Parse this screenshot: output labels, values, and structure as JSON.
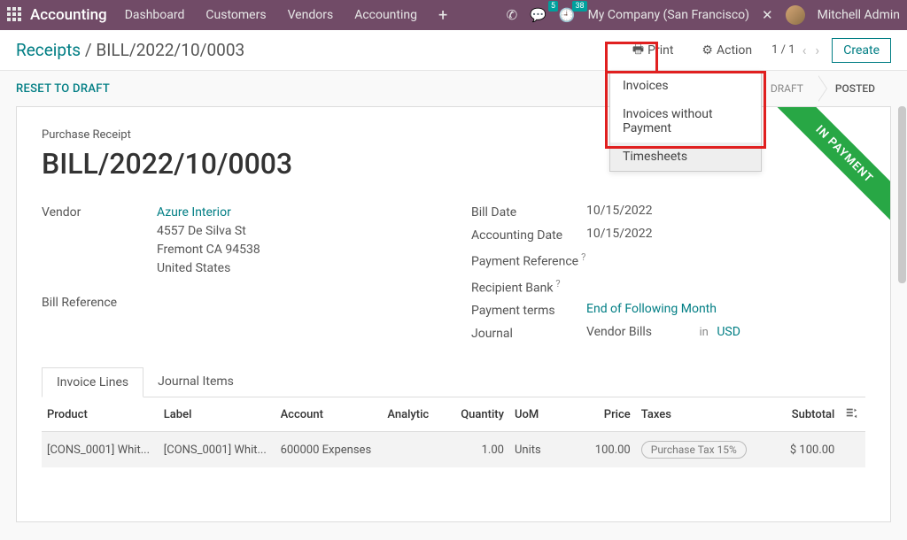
{
  "topbar": {
    "app_name": "Accounting",
    "nav": [
      "Dashboard",
      "Customers",
      "Vendors",
      "Accounting"
    ],
    "messages_count": "5",
    "activities_count": "38",
    "company": "My Company (San Francisco)",
    "user": "Mitchell Admin"
  },
  "breadcrumb": {
    "root": "Receipts",
    "current": "BILL/2022/10/0003"
  },
  "controls": {
    "print": "Print",
    "action": "Action",
    "pager": "1 / 1",
    "create": "Create"
  },
  "print_menu": [
    "Invoices",
    "Invoices without Payment",
    "Timesheets"
  ],
  "statusbar": {
    "reset": "Reset To Draft",
    "draft": "Draft",
    "posted": "Posted"
  },
  "ribbon": "In Payment",
  "record": {
    "title_label": "Purchase Receipt",
    "title": "BILL/2022/10/0003",
    "vendor_label": "Vendor",
    "vendor_name": "Azure Interior",
    "vendor_addr1": "4557 De Silva St",
    "vendor_addr2": "Fremont CA 94538",
    "vendor_country": "United States",
    "bill_ref_label": "Bill Reference",
    "bill_date_label": "Bill Date",
    "bill_date": "10/15/2022",
    "acc_date_label": "Accounting Date",
    "acc_date": "10/15/2022",
    "pay_ref_label": "Payment Reference",
    "recip_bank_label": "Recipient Bank",
    "terms_label": "Payment terms",
    "terms": "End of Following Month",
    "journal_label": "Journal",
    "journal": "Vendor Bills",
    "in": "in",
    "currency": "USD"
  },
  "tabs": {
    "lines": "Invoice Lines",
    "journal": "Journal Items"
  },
  "columns": {
    "product": "Product",
    "label": "Label",
    "account": "Account",
    "analytic": "Analytic",
    "qty": "Quantity",
    "uom": "UoM",
    "price": "Price",
    "taxes": "Taxes",
    "subtotal": "Subtotal"
  },
  "lines": [
    {
      "product": "[CONS_0001] Whit...",
      "label": "[CONS_0001] Whit...",
      "account": "600000 Expenses",
      "analytic": "",
      "qty": "1.00",
      "uom": "Units",
      "price": "100.00",
      "tax": "Purchase Tax 15%",
      "subtotal": "$ 100.00"
    }
  ]
}
